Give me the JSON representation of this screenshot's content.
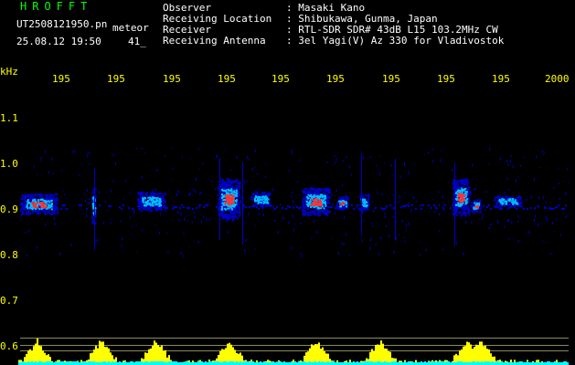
{
  "header": {
    "brand": "HROFFT",
    "filename": "UT2508121950.pn",
    "mode": "meteor",
    "datetime": "25.08.12 19:50",
    "extra": "41_",
    "fields": [
      {
        "label": "Observer",
        "value": "Masaki Kano"
      },
      {
        "label": "Receiving Location",
        "value": "Shibukawa, Gunma, Japan"
      },
      {
        "label": "Receiver",
        "value": "RTL-SDR SDR# 43dB L15 103.2MHz CW"
      },
      {
        "label": "Receiving Antenna",
        "value": "3el Yagi(V) Az 330 for Vladivostok"
      }
    ]
  },
  "spectrogram": {
    "y_unit": "kHz",
    "y_ticks": [
      "1.1",
      "1.0",
      "0.9",
      "0.8",
      "0.7",
      "0.6"
    ],
    "x_ticks": [
      "195",
      "195",
      "195",
      "195",
      "195",
      "195",
      "195",
      "195",
      "195",
      "2000"
    ]
  },
  "colors": {
    "background": "#000000",
    "header_text": "#ffffff",
    "brand": "#00ff00",
    "axis_text": "#ffff00",
    "signal_low": "#0000c8",
    "signal_mid": "#00c0ff",
    "signal_high": "#ff3030",
    "histogram_yellow": "#ffff00",
    "histogram_cyan": "#00ffff"
  }
}
